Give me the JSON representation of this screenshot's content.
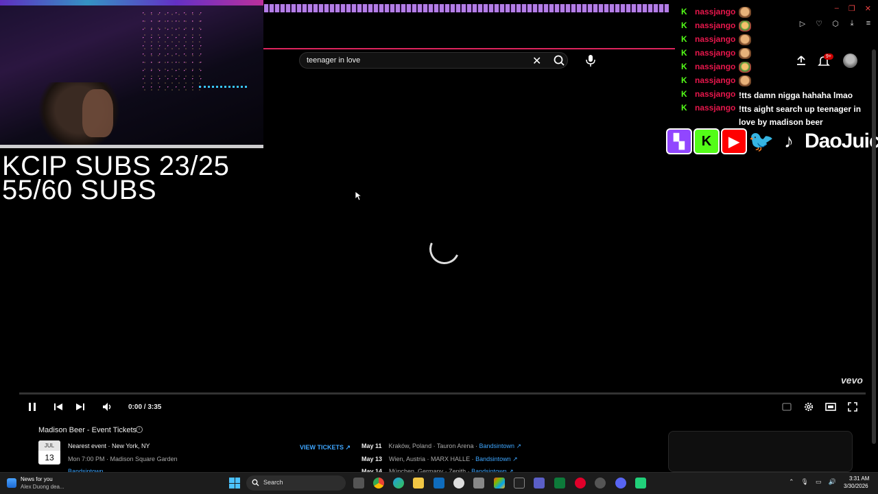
{
  "overlay": {
    "subs_line1": "KCIP SUBS 23/25",
    "subs_line2": "55/60 SUBS",
    "social_handle": "DaoJuice"
  },
  "youtube": {
    "search_value": "teenager in love",
    "notification_badge": "9+",
    "watermark": "vevo",
    "player": {
      "time": "0:00 / 3:35",
      "progress": 0,
      "state": "loading"
    }
  },
  "chat": {
    "messages": [
      {
        "platform": "kick",
        "user": "nassjango",
        "text": "",
        "emote": "face"
      },
      {
        "platform": "kick",
        "user": "nassjango",
        "text": "",
        "emote": "face-green"
      },
      {
        "platform": "kick",
        "user": "nassjango",
        "text": "",
        "emote": "face"
      },
      {
        "platform": "kick",
        "user": "nassjango",
        "text": "",
        "emote": "face-green"
      },
      {
        "platform": "kick",
        "user": "nassjango",
        "text": "",
        "emote": "face"
      },
      {
        "platform": "kick",
        "user": "nassjango",
        "text": "!tts damn nigga hahaha lmao",
        "emote": ""
      },
      {
        "platform": "kick",
        "user": "nassjango",
        "text": "!tts aight search up teenager in love by madison beer",
        "emote": ""
      }
    ],
    "k_glyph": "K",
    "user_color": "#e8174c",
    "kick_color": "#53fc18"
  },
  "events": {
    "title": "Madison Beer - Event Tickets",
    "nearest": {
      "month": "JUL",
      "day": "13",
      "label": "Nearest event · New York, NY",
      "detail": "Mon 7:00 PM · Madison Square Garden",
      "source": "Bandsintown"
    },
    "view_tickets": "VIEW TICKETS ↗",
    "list": [
      {
        "date": "May 11",
        "place": "Kraków, Poland · Tauron Arena  ·  ",
        "source": "Bandsintown ↗"
      },
      {
        "date": "May 13",
        "place": "Wien, Austria · MARX HALLE  ·  ",
        "source": "Bandsintown ↗"
      },
      {
        "date": "May 14",
        "place": "München, Germany · Zenith  ·  ",
        "source": "Bandsintown ↗"
      }
    ]
  },
  "taskbar": {
    "news_title": "News for you",
    "news_sub": "Alex Duong dea...",
    "search_label": "Search",
    "time": "3:31 AM",
    "date": "3/30/2026"
  },
  "colors": {
    "accent_red": "#ff0000",
    "link_blue": "#3ea6ff"
  }
}
